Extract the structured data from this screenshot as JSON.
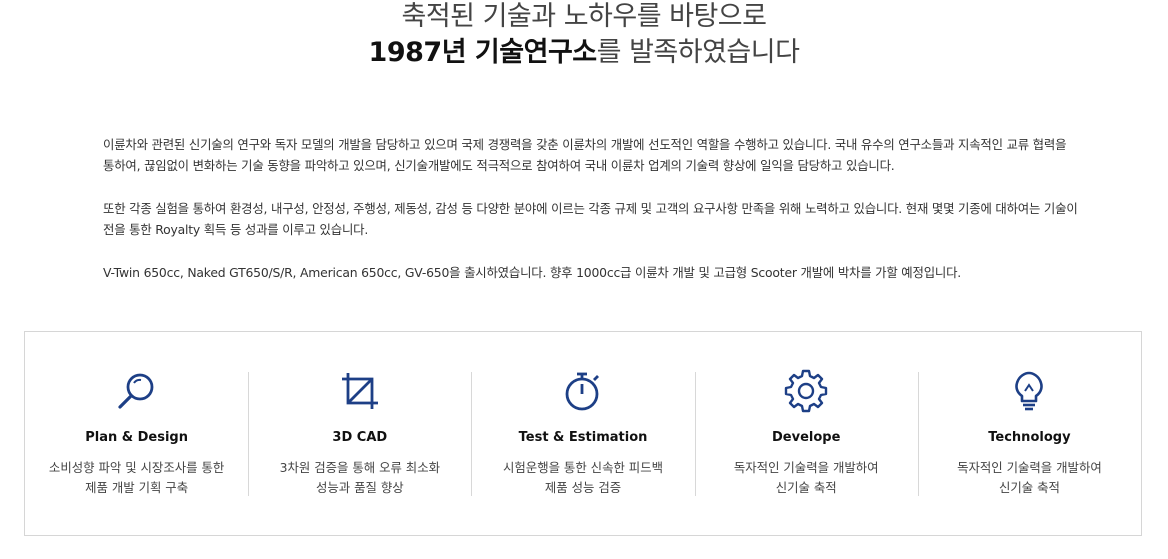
{
  "heading": {
    "line1": "축적된 기술과 노하우를 바탕으로",
    "line2_bold": "1987년 기술연구소",
    "line2_rest": "를 발족하였습니다"
  },
  "paragraphs": [
    "이륜차와 관련된 신기술의 연구와 독자 모델의 개발을 담당하고 있으며 국제 경쟁력을 갖춘 이륜차의 개발에 선도적인 역할을 수행하고 있습니다. 국내 유수의 연구소들과 지속적인 교류 협력을 통하여, 끊임없이 변화하는 기술 동향을 파악하고 있으며, 신기술개발에도 적극적으로 참여하여 국내 이륜차 업계의 기술력 향상에 일익을 담당하고 있습니다.",
    "또한 각종 실험을 통하여 환경성, 내구성, 안정성, 주행성, 제동성, 감성 등 다양한 분야에 이르는 각종 규제 및 고객의 요구사항 만족을 위해 노력하고 있습니다. 현재 몇몇 기종에 대하여는 기술이전을 통한 Royalty 획득 등 성과를 이루고 있습니다.",
    "V-Twin 650cc, Naked GT650/S/R, American 650cc, GV-650을 출시하였습니다. 향후 1000cc급 이륜차 개발 및 고급형 Scooter 개발에 박차를 가할 예정입니다."
  ],
  "accent_color": "#1d3f86",
  "features": [
    {
      "icon": "search-icon",
      "title": "Plan & Design",
      "desc": [
        "소비성향 파악 및 시장조사를 통한",
        "제품 개발 기획 구축"
      ]
    },
    {
      "icon": "crop-icon",
      "title": "3D CAD",
      "desc": [
        "3차원 검증을 통해 오류 최소화",
        "성능과 품질 향상"
      ]
    },
    {
      "icon": "stopwatch-icon",
      "title": "Test & Estimation",
      "desc": [
        "시험운행을 통한 신속한 피드백",
        "제품 성능 검증"
      ]
    },
    {
      "icon": "gear-icon",
      "title": "Develope",
      "desc": [
        "독자적인 기술력을 개발하여",
        "신기술 축적"
      ]
    },
    {
      "icon": "lightbulb-icon",
      "title": "Technology",
      "desc": [
        "독자적인 기술력을 개발하여",
        "신기술 축적"
      ]
    }
  ]
}
